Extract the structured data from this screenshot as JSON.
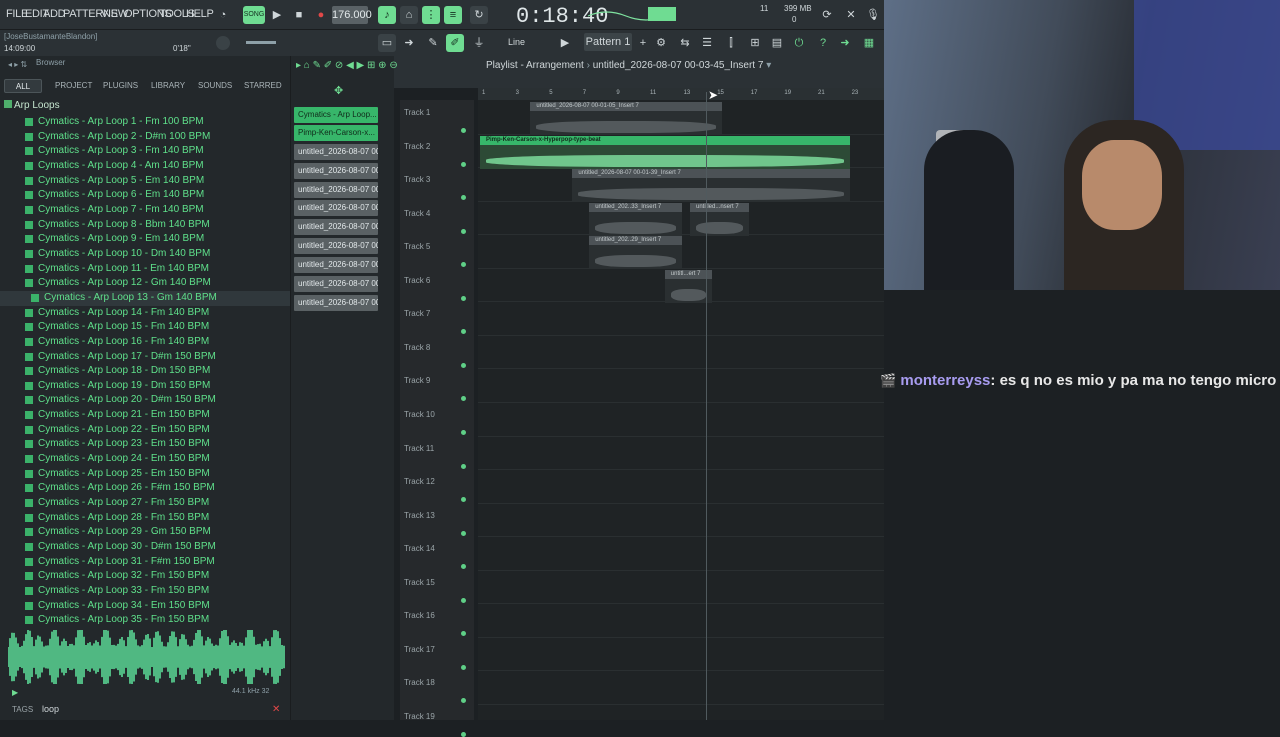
{
  "menu": [
    "FILE",
    "EDIT",
    "ADD",
    "PATTERNS",
    "VIEW",
    "OPTIONS",
    "TOOLS",
    "HELP"
  ],
  "transport": {
    "tempo": "176.000",
    "time": "0:18:40",
    "pattern": "Pattern 1",
    "snap": "Line",
    "mem": "399 MB",
    "cpu_top": "11",
    "cpu_bottom": "0"
  },
  "project": {
    "user": "[JoseBustamanteBlandon]",
    "time": "14:09:00",
    "duration": "0'18\""
  },
  "browser": {
    "title": "Browser",
    "tabs": [
      "ALL",
      "PROJECT",
      "PLUGINS",
      "LIBRARY",
      "SOUNDS",
      "STARRED"
    ],
    "folder": "Arp Loops",
    "files": [
      "Cymatics - Arp Loop 1 - Fm 100 BPM",
      "Cymatics - Arp Loop 2 - D#m 100 BPM",
      "Cymatics - Arp Loop 3 - Fm 140 BPM",
      "Cymatics - Arp Loop 4 - Am 140 BPM",
      "Cymatics - Arp Loop 5 - Em 140 BPM",
      "Cymatics - Arp Loop 6 - Em 140 BPM",
      "Cymatics - Arp Loop 7 - Fm 140 BPM",
      "Cymatics - Arp Loop 8 - Bbm 140 BPM",
      "Cymatics - Arp Loop 9 - Em 140 BPM",
      "Cymatics - Arp Loop 10 - Dm 140 BPM",
      "Cymatics - Arp Loop 11 - Em 140 BPM",
      "Cymatics - Arp Loop 12 - Gm 140 BPM",
      "Cymatics - Arp Loop 13 - Gm 140 BPM",
      "Cymatics - Arp Loop 14 - Fm 140 BPM",
      "Cymatics - Arp Loop 15 - Fm 140 BPM",
      "Cymatics - Arp Loop 16 - Fm 140 BPM",
      "Cymatics - Arp Loop 17 - D#m 150 BPM",
      "Cymatics - Arp Loop 18 - Dm 150 BPM",
      "Cymatics - Arp Loop 19 - Dm 150 BPM",
      "Cymatics - Arp Loop 20 - D#m 150 BPM",
      "Cymatics - Arp Loop 21 - Em 150 BPM",
      "Cymatics - Arp Loop 22 - Em 150 BPM",
      "Cymatics - Arp Loop 23 - Em 150 BPM",
      "Cymatics - Arp Loop 24 - Em 150 BPM",
      "Cymatics - Arp Loop 25 - Em 150 BPM",
      "Cymatics - Arp Loop 26 - F#m 150 BPM",
      "Cymatics - Arp Loop 27 - Fm 150 BPM",
      "Cymatics - Arp Loop 28 - Fm 150 BPM",
      "Cymatics - Arp Loop 29 - Gm 150 BPM",
      "Cymatics - Arp Loop 30 - D#m 150 BPM",
      "Cymatics - Arp Loop 31 - F#m 150 BPM",
      "Cymatics - Arp Loop 32 - Fm 150 BPM",
      "Cymatics - Arp Loop 33 - Fm 150 BPM",
      "Cymatics - Arp Loop 34 - Em 150 BPM",
      "Cymatics - Arp Loop 35 - Fm 150 BPM"
    ],
    "selected_index": 12,
    "sample_rate": "44.1 kHz 32",
    "tags_label": "TAGS",
    "tags_value": "loop"
  },
  "picker": [
    "Cymatics - Arp Loop...",
    "Pimp-Ken-Carson-x...",
    "untitled_2026-08-07 00-...",
    "untitled_2026-08-07 00-...",
    "untitled_2026-08-07 00-...",
    "untitled_2026-08-07 00-...",
    "untitled_2026-08-07 00-...",
    "untitled_2026-08-07 00-...",
    "untitled_2026-08-07 00-...",
    "untitled_2026-08-07 00-...",
    "untitled_2026-08-07 00-..."
  ],
  "playlist": {
    "title": "Playlist - Arrangement",
    "arrangement": "untitled_2026-08-07 00-03-45_Insert 7",
    "ruler": [
      "1",
      "3",
      "5",
      "7",
      "9",
      "11",
      "13",
      "15",
      "17",
      "19",
      "21",
      "23"
    ],
    "tracks": [
      "Track 1",
      "Track 2",
      "Track 3",
      "Track 4",
      "Track 5",
      "Track 6",
      "Track 7",
      "Track 8",
      "Track 9",
      "Track 10",
      "Track 11",
      "Track 12",
      "Track 13",
      "Track 14",
      "Track 15",
      "Track 16",
      "Track 17",
      "Track 18",
      "Track 19"
    ],
    "clips": [
      {
        "label": "untitled_2026-08-07 00-01-05_Insert 7",
        "track": 1,
        "start": 4,
        "len": 11.4,
        "green": false
      },
      {
        "label": "Pimp-Ken-Carson-x-Hyperpop-type-beat",
        "track": 2,
        "start": 1,
        "len": 22,
        "green": true
      },
      {
        "label": "untitled_2026-08-07 00-01-39_Insert 7",
        "track": 3,
        "start": 6.5,
        "len": 16.5,
        "green": false
      },
      {
        "label": "untitled_202..33_Insert 7",
        "track": 4,
        "start": 7.5,
        "len": 5.5,
        "green": false
      },
      {
        "label": "untitled...nsert 7",
        "track": 4,
        "start": 13.5,
        "len": 3.5,
        "green": false
      },
      {
        "label": "untitled_202..29_Insert 7",
        "track": 5,
        "start": 7.5,
        "len": 5.5,
        "green": false
      },
      {
        "label": "untitl...ert 7",
        "track": 6,
        "start": 12,
        "len": 2.8,
        "green": false
      }
    ]
  },
  "chat": {
    "user": "monterreyss",
    "message": ": es q no es mio y pa ma no tengo micro"
  }
}
